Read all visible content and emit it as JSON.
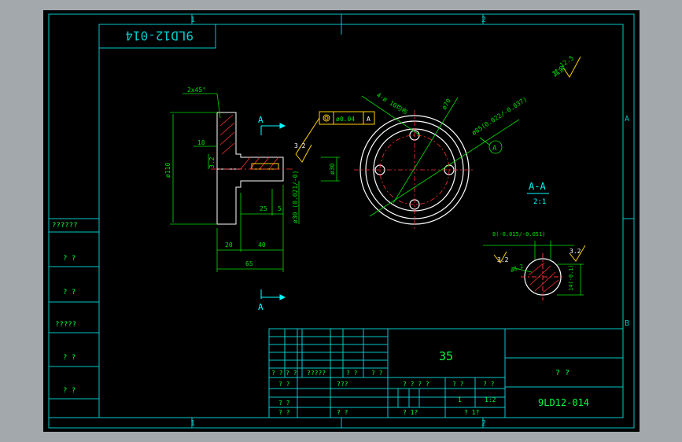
{
  "colors": {
    "window_bg": "#a3a8ac",
    "canvas_bg": "#000000",
    "frame": "#00c8c8",
    "part": "#ffffff",
    "dimension": "#00e000",
    "section_mark": "#00ffff",
    "datum": "#ff3030",
    "accent": "#ffd000"
  },
  "drawing": {
    "reversed_label": "9LD12-014",
    "zone_columns": [
      "1",
      "2"
    ],
    "zone_rows": [
      "A",
      "B"
    ],
    "surface_finish_label": "其余",
    "surface_finish_value": "12.5",
    "section_label": "A-A",
    "section_scale": "2:1",
    "datum_symbol": "A",
    "cut_mark_top": "A",
    "cut_mark_bottom": "A"
  },
  "side_view_dims": {
    "chamfer": "2x45°",
    "diameter_outer": "ø110",
    "shoulder": "10",
    "step": "3.2",
    "bore": "ø30",
    "fit": "ø30 (0.021/-0)",
    "roughness": "3.2",
    "gd_tol_value": "ø0.04",
    "gd_tol_datum": "A",
    "len_25": "25",
    "len_5": "5",
    "len_20": "20",
    "len_40": "40",
    "len_65": "65"
  },
  "front_view_dims": {
    "holes": "4-ø 10均布",
    "pcd": "ø70",
    "hub": "ø85(0.022/-0.037)"
  },
  "key_section_dims": {
    "width": "8(-0.015/-0.051)",
    "roughness_left": "3.2",
    "roughness_right": "3.2",
    "radius": "ø8.2",
    "depth": "14(-0.1)"
  },
  "left_strip": [
    "??????",
    "? ?",
    "? ?",
    "?????",
    "? ?",
    "? ?"
  ],
  "title_block": {
    "material": "35",
    "name": "? ?",
    "number": "9LD12-014",
    "rev_headers": [
      "? ?",
      "? ?",
      "?????",
      "? ?",
      "? ?"
    ],
    "sign_rows": [
      "? ?",
      "? ?",
      "? ?"
    ],
    "sign_rows_b": [
      "???",
      "? ?"
    ],
    "stage_label": "? ? ? ?",
    "weight_label": "? ?",
    "scale_label": "? ?",
    "qty": "1",
    "scale": "1:2",
    "sheet_a": "? 1?",
    "sheet_b": "? 1?"
  }
}
